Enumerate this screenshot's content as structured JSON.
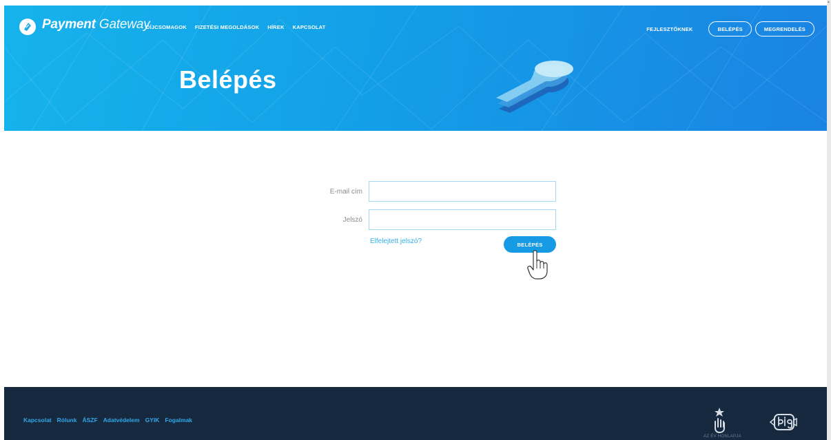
{
  "header": {
    "logo": {
      "brand_bold": "Payment",
      "brand_light": "Gateway"
    },
    "nav": [
      {
        "label": "DÍJCSOMAGOK"
      },
      {
        "label": "FIZETÉSI MEGOLDÁSOK"
      },
      {
        "label": "HÍREK"
      },
      {
        "label": "KAPCSOLAT"
      }
    ],
    "developers_label": "FEJLESZTŐKNEK",
    "login_pill": "BELÉPÉS",
    "order_pill": "MEGRENDELÉS",
    "title": "Belépés"
  },
  "form": {
    "email_label": "E-mail cím",
    "email_value": "",
    "password_label": "Jelszó",
    "password_value": "",
    "forgot_label": "Elfelejtett jelszó?",
    "submit_label": "BELÉPÉS"
  },
  "footer": {
    "links": [
      {
        "label": "Kapcsolat"
      },
      {
        "label": "Rólunk"
      },
      {
        "label": "ÁSZF"
      },
      {
        "label": "Adatvédelem"
      },
      {
        "label": "GYIK"
      },
      {
        "label": "Fogalmak"
      }
    ],
    "award_text": "AZ ÉV HONLAPJA"
  },
  "colors": {
    "hero_start": "#16b3ec",
    "hero_end": "#1a83e3",
    "accent": "#159ae3",
    "footer_bg": "#17293f",
    "footer_link": "#2fa8ea"
  },
  "icons": {
    "logo": "payment-gateway-logo-icon",
    "key_illustration": "keyhole-key-icon",
    "cursor": "hand-pointer-icon",
    "award": "star-hand-award-icon",
    "partner": "bigfish-logo-icon"
  }
}
